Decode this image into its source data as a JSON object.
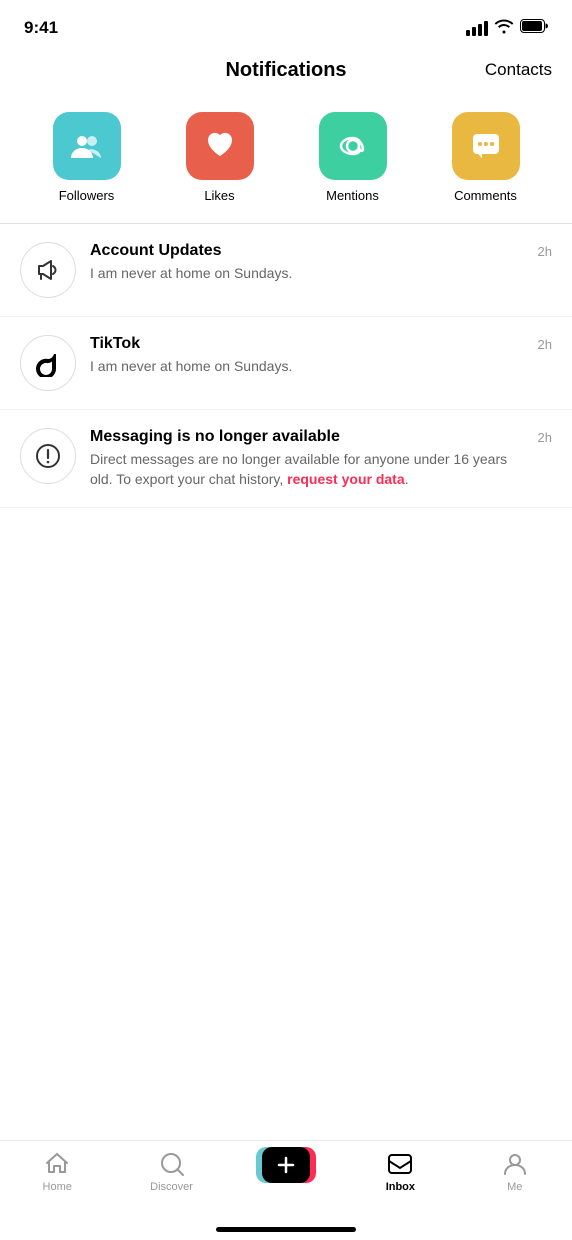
{
  "statusBar": {
    "time": "9:41"
  },
  "header": {
    "title": "Notifications",
    "contactsLabel": "Contacts"
  },
  "categories": [
    {
      "id": "followers",
      "label": "Followers",
      "color": "#4cc9d0",
      "icon": "followers"
    },
    {
      "id": "likes",
      "label": "Likes",
      "color": "#e8604c",
      "icon": "heart"
    },
    {
      "id": "mentions",
      "label": "Mentions",
      "color": "#3ecfa0",
      "icon": "at"
    },
    {
      "id": "comments",
      "label": "Comments",
      "color": "#e8b840",
      "icon": "comment"
    }
  ],
  "notifications": [
    {
      "id": "account-updates",
      "title": "Account Updates",
      "message": "I am never at home on Sundays.",
      "time": "2h",
      "icon": "megaphone"
    },
    {
      "id": "tiktok",
      "title": "TikTok",
      "message": "I am never at home on Sundays.",
      "time": "2h",
      "icon": "tiktok"
    },
    {
      "id": "messaging",
      "title": "Messaging is no longer available",
      "messagePart1": "Direct messages are no longer available for anyone under 16 years old. To export your chat history, ",
      "linkText": "request your data",
      "messagePart2": ".",
      "time": "2h",
      "icon": "exclamation"
    }
  ],
  "bottomNav": [
    {
      "id": "home",
      "label": "Home",
      "active": false
    },
    {
      "id": "discover",
      "label": "Discover",
      "active": false
    },
    {
      "id": "add",
      "label": "",
      "active": false
    },
    {
      "id": "inbox",
      "label": "Inbox",
      "active": true
    },
    {
      "id": "me",
      "label": "Me",
      "active": false
    }
  ]
}
